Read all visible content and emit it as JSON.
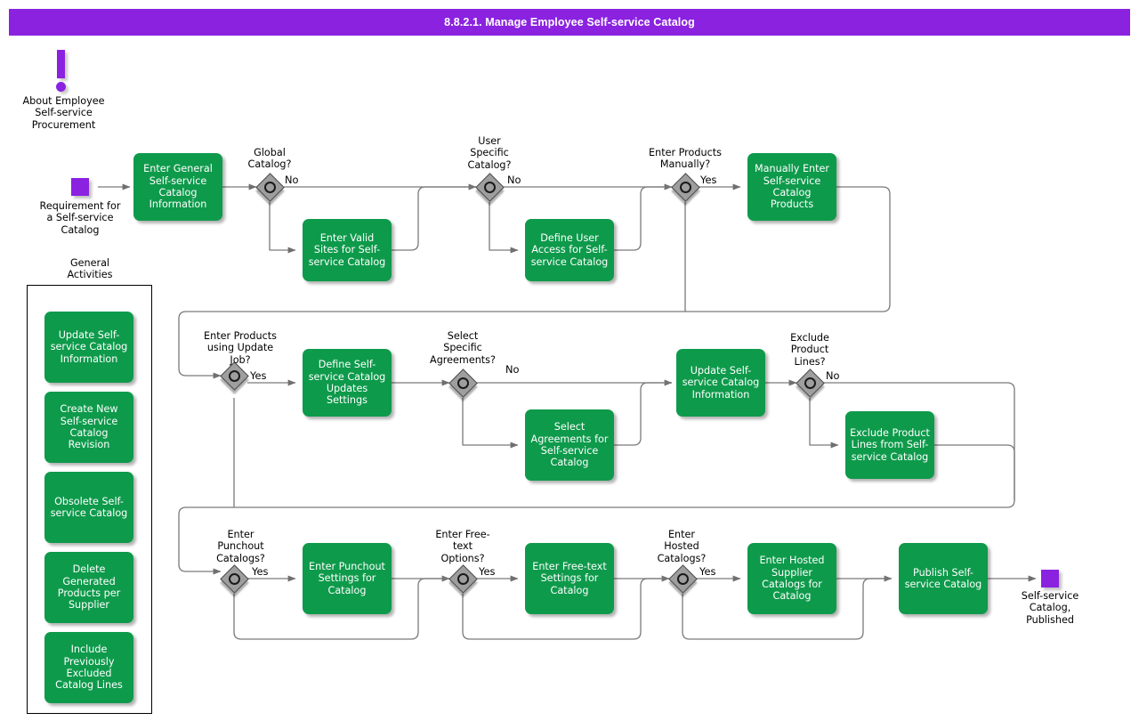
{
  "header": {
    "title": "8.8.2.1. Manage Employee Self-service Catalog",
    "accent_color": "#8A22E0"
  },
  "colors": {
    "activity_fill": "#0E9A4B",
    "event_fill": "#8A22E0",
    "gateway_fill": "#9E9E9E",
    "connector": "#7a7a7a",
    "text_on_activity": "#FFFFFF"
  },
  "note": {
    "icon": "exclamation-icon",
    "label": "About Employee\nSelf-service\nProcurement",
    "line1": "About Employee",
    "line2": "Self-service",
    "line3": "Procurement"
  },
  "start_event": {
    "label": "Requirement for\na Self-service\nCatalog",
    "line1": "Requirement for",
    "line2": "a Self-service",
    "line3": "Catalog"
  },
  "end_event": {
    "label": "Self-service\nCatalog,\nPublished",
    "line1": "Self-service",
    "line2": "Catalog,",
    "line3": "Published"
  },
  "general_activities": {
    "title_line1": "General",
    "title_line2": "Activities",
    "items": [
      {
        "label": "Update Self-service Catalog Information"
      },
      {
        "label": "Create New Self-service Catalog Revision"
      },
      {
        "label": "Obsolete Self-service Catalog"
      },
      {
        "label": "Delete Generated Products per Supplier"
      },
      {
        "label": "Include Previously Excluded Catalog Lines"
      }
    ]
  },
  "activities": [
    {
      "id": "enter-general-info",
      "label": "Enter General Self-service Catalog Information"
    },
    {
      "id": "enter-valid-sites",
      "label": "Enter Valid Sites for Self-service Catalog"
    },
    {
      "id": "define-user-access",
      "label": "Define User Access for Self-service Catalog"
    },
    {
      "id": "manually-enter-products",
      "label": "Manually Enter Self-service Catalog Products"
    },
    {
      "id": "define-updates-settings",
      "label": "Define Self-service Catalog Updates Settings"
    },
    {
      "id": "select-agreements",
      "label": "Select Agreements for Self-service Catalog"
    },
    {
      "id": "update-catalog-info",
      "label": "Update Self-service Catalog Information"
    },
    {
      "id": "exclude-product-lines",
      "label": "Exclude Product Lines from Self-service Catalog"
    },
    {
      "id": "enter-punchout-settings",
      "label": "Enter Punchout Settings for Catalog"
    },
    {
      "id": "enter-free-text-settings",
      "label": "Enter Free-text Settings for Catalog"
    },
    {
      "id": "enter-hosted-supplier",
      "label": "Enter Hosted Supplier Catalogs for Catalog"
    },
    {
      "id": "publish-catalog",
      "label": "Publish Self-service Catalog"
    }
  ],
  "gateways": [
    {
      "id": "global-catalog",
      "line1": "Global",
      "line2": "Catalog?",
      "line3": "",
      "branch": "No"
    },
    {
      "id": "user-specific",
      "line1": "User",
      "line2": "Specific",
      "line3": "Catalog?",
      "branch": "No"
    },
    {
      "id": "enter-products-man",
      "line1": "Enter Products",
      "line2": "Manually?",
      "line3": "",
      "branch": "Yes"
    },
    {
      "id": "products-update-job",
      "line1": "Enter Products",
      "line2": "using Update",
      "line3": "Job?",
      "branch": "Yes"
    },
    {
      "id": "select-specific-agr",
      "line1": "Select",
      "line2": "Specific",
      "line3": "Agreements?",
      "branch": "No"
    },
    {
      "id": "exclude-prod-lines",
      "line1": "Exclude",
      "line2": "Product",
      "line3": "Lines?",
      "branch": "No"
    },
    {
      "id": "punchout-catalogs",
      "line1": "Enter",
      "line2": "Punchout",
      "line3": "Catalogs?",
      "branch": "Yes"
    },
    {
      "id": "free-text-options",
      "line1": "Enter Free-",
      "line2": "text",
      "line3": "Options?",
      "branch": "Yes"
    },
    {
      "id": "hosted-catalogs",
      "line1": "Enter",
      "line2": "Hosted",
      "line3": "Catalogs?",
      "branch": "Yes"
    }
  ]
}
